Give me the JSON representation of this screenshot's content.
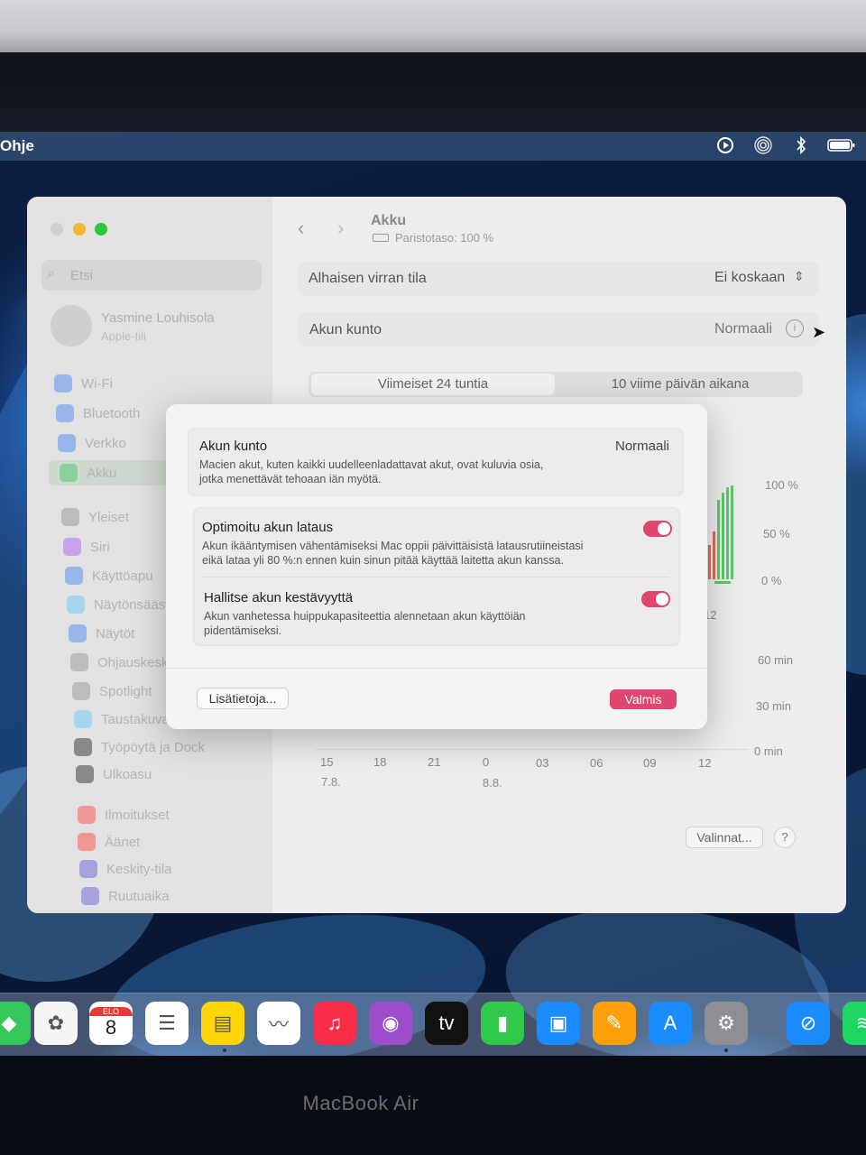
{
  "menubar": {
    "help_label": "Ohje",
    "status_icons": [
      "play-circle-icon",
      "airdrop-icon",
      "bluetooth-icon",
      "battery-icon"
    ]
  },
  "window": {
    "title": "Akku",
    "subtitle": "Paristotaso: 100 %",
    "search_placeholder": "Etsi",
    "user": {
      "name": "Yasmine Louhisola",
      "subtitle": "Apple-tili"
    },
    "sidebar_items": [
      {
        "label": "Wi-Fi",
        "icon": "wifi-icon",
        "color": "#3b82f6"
      },
      {
        "label": "Bluetooth",
        "icon": "bluetooth-icon",
        "color": "#3b82f6"
      },
      {
        "label": "Verkko",
        "icon": "globe-icon",
        "color": "#3b82f6"
      },
      {
        "label": "Akku",
        "icon": "battery-icon",
        "color": "#34c759"
      },
      {
        "label": "Yleiset",
        "icon": "gear-icon",
        "color": "#8e8e93"
      },
      {
        "label": "Siri",
        "icon": "siri-icon",
        "color": "#a855f7"
      },
      {
        "label": "Käyttöapu",
        "icon": "accessibility-icon",
        "color": "#3b82f6"
      },
      {
        "label": "Näytönsäästäjä",
        "icon": "screensaver-icon",
        "color": "#5ac8fa"
      },
      {
        "label": "Näytöt",
        "icon": "display-icon",
        "color": "#3b82f6"
      },
      {
        "label": "Ohjauskeskus",
        "icon": "control-center-icon",
        "color": "#8e8e93"
      },
      {
        "label": "Spotlight",
        "icon": "spotlight-icon",
        "color": "#8e8e93"
      },
      {
        "label": "Taustakuva",
        "icon": "wallpaper-icon",
        "color": "#5ac8fa"
      },
      {
        "label": "Työpöytä ja Dock",
        "icon": "dock-icon",
        "color": "#1c1c1e"
      },
      {
        "label": "Ulkoasu",
        "icon": "appearance-icon",
        "color": "#1c1c1e"
      },
      {
        "label": "Ilmoitukset",
        "icon": "bell-icon",
        "color": "#ff3b30"
      },
      {
        "label": "Äänet",
        "icon": "speaker-icon",
        "color": "#ff3b30"
      },
      {
        "label": "Keskity-tila",
        "icon": "moon-icon",
        "color": "#5856d6"
      },
      {
        "label": "Ruutuaika",
        "icon": "hourglass-icon",
        "color": "#5856d6"
      }
    ],
    "low_power": {
      "label": "Alhaisen virran tila",
      "value": "Ei koskaan"
    },
    "health": {
      "label": "Akun kunto",
      "value": "Normaali"
    },
    "segments": [
      "Viimeiset 24 tuntia",
      "10 viime päivän aikana"
    ],
    "level_axis": [
      "100 %",
      "50 %",
      "0 %"
    ],
    "usage_axis": [
      "60 min",
      "30 min",
      "0 min"
    ],
    "time_ticks": [
      "15",
      "18",
      "21",
      "0",
      "03",
      "06",
      "09",
      "12"
    ],
    "date_ticks": [
      "7.8.",
      "8.8."
    ],
    "tick_12_partial": "12",
    "options_label": "Valinnat...",
    "help_label": "?"
  },
  "sheet": {
    "health_title": "Akun kunto",
    "health_value": "Normaali",
    "health_desc_1": "Macien akut, kuten kaikki uudelleenladattavat akut, ovat kuluvia osia,",
    "health_desc_2": "jotka menettävät tehoaan iän myötä.",
    "opt_title": "Optimoitu akun lataus",
    "opt_desc_1": "Akun ikääntymisen vähentämiseksi Mac oppii päivittäisistä latausrutiineistasi",
    "opt_desc_2": "eikä lataa yli 80 %:n ennen kuin sinun pitää käyttää laitetta akun kanssa.",
    "opt_on": true,
    "manage_title": "Hallitse akun kestävyyttä",
    "manage_desc_1": "Akun vanhetessa huippukapasiteettia alennetaan akun käyttöiän",
    "manage_desc_2": "pidentämiseksi.",
    "manage_on": true,
    "more_button": "Lisätietoja...",
    "done_button": "Valmis",
    "accent": "#e0456e"
  },
  "dock": {
    "apps": [
      {
        "name": "maps-icon",
        "color": "#34c759",
        "glyph": "◆"
      },
      {
        "name": "photos-icon",
        "color": "#f5f5f5",
        "glyph": "✿"
      },
      {
        "name": "calendar-icon",
        "color": "#ffffff",
        "glyph": "8",
        "top_label": "ELO"
      },
      {
        "name": "reminders-icon",
        "color": "#ffffff",
        "glyph": "☰"
      },
      {
        "name": "notes-icon",
        "color": "#ffd60a",
        "glyph": "▤"
      },
      {
        "name": "freeform-icon",
        "color": "#ffffff",
        "glyph": "〰"
      },
      {
        "name": "music-icon",
        "color": "#fa2d48",
        "glyph": "♫"
      },
      {
        "name": "podcasts-icon",
        "color": "#9b4dca",
        "glyph": "◉"
      },
      {
        "name": "tv-icon",
        "color": "#111111",
        "glyph": "tv"
      },
      {
        "name": "numbers-icon",
        "color": "#30c94b",
        "glyph": "▮"
      },
      {
        "name": "keynote-icon",
        "color": "#1a8cff",
        "glyph": "▣"
      },
      {
        "name": "pages-icon",
        "color": "#ff9f0a",
        "glyph": "✎"
      },
      {
        "name": "app-store-icon",
        "color": "#1a8cff",
        "glyph": "A"
      },
      {
        "name": "system-settings-icon",
        "color": "#8e8e93",
        "glyph": "⚙"
      },
      {
        "name": "safari-icon",
        "color": "#1a8cff",
        "glyph": "⊘"
      },
      {
        "name": "spotify-icon",
        "color": "#1ed760",
        "glyph": "≋"
      }
    ]
  },
  "device_brand": "MacBook Air"
}
